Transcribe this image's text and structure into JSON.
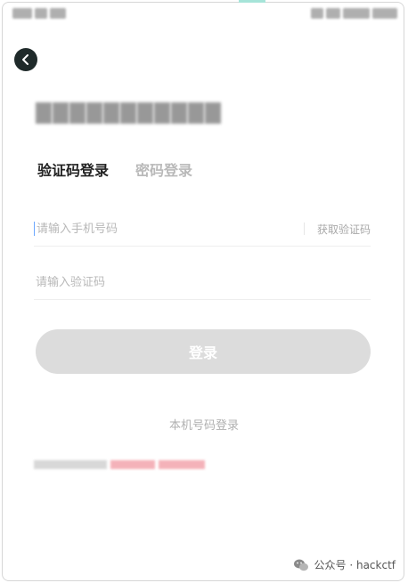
{
  "tabs": {
    "sms_login": "验证码登录",
    "password_login": "密码登录"
  },
  "phone_field": {
    "placeholder": "请输入手机号码",
    "get_code_label": "获取验证码"
  },
  "code_field": {
    "placeholder": "请输入验证码"
  },
  "login_button_label": "登录",
  "local_number_login": "本机号码登录",
  "watermark": {
    "account": "公众号 · hackctf",
    "icon": "wechat-icon"
  },
  "icons": {
    "back": "chevron-left-icon"
  },
  "colors": {
    "login_button_bg": "#dcdcdc",
    "back_button_bg": "#1f2a2a",
    "agreement_link": "#f2a0a8"
  }
}
